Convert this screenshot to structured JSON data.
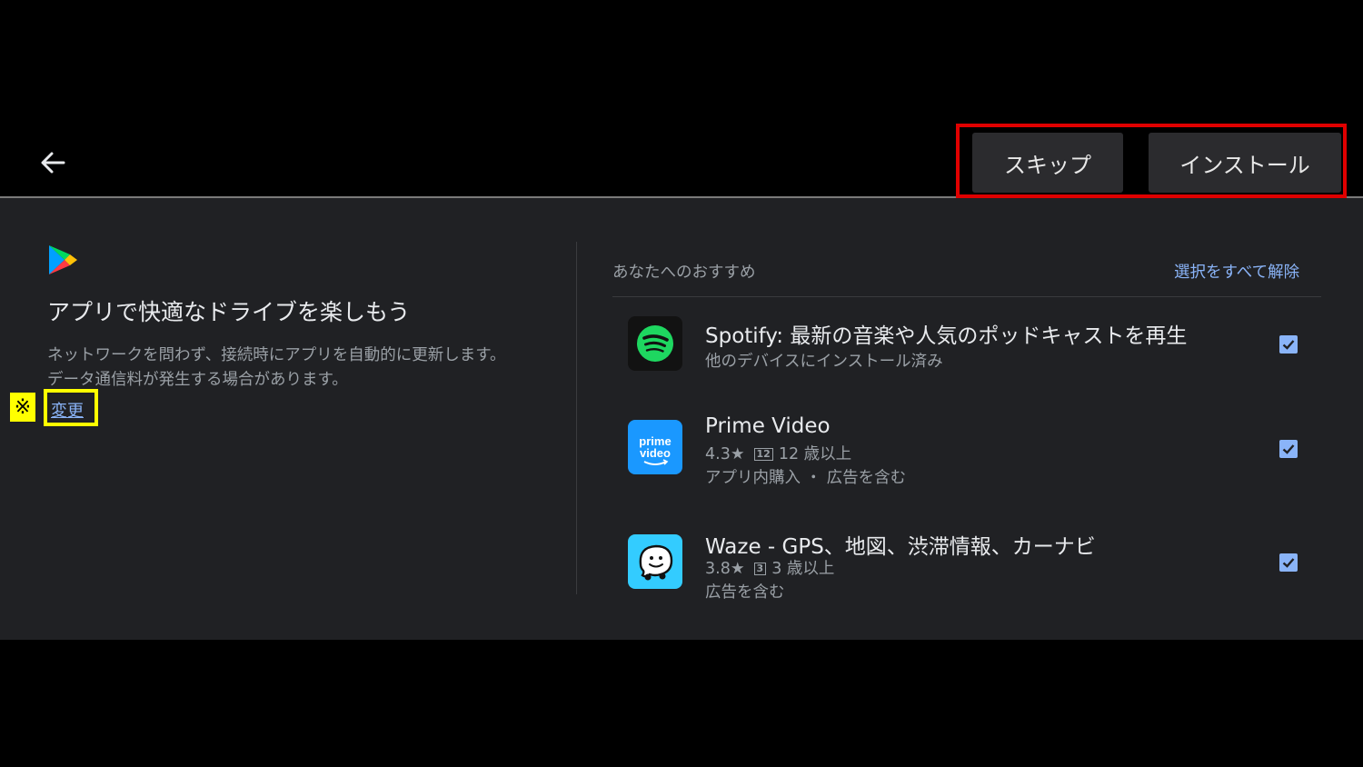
{
  "header": {
    "skip_label": "スキップ",
    "install_label": "インストール"
  },
  "left": {
    "title": "アプリで快適なドライブを楽しもう",
    "desc_line1": "ネットワークを問わず、接続時にアプリを自動的に更新します。",
    "desc_line2": "データ通信料が発生する場合があります。",
    "change_link": "変更",
    "note_mark": "※"
  },
  "recommend": {
    "label": "あなたへのおすすめ",
    "deselect_all": "選択をすべて解除",
    "apps": [
      {
        "title": "Spotify: 最新の音楽や人気のポッドキャストを再生",
        "line1": "他のデバイスにインストール済み",
        "icon": "spotify-icon",
        "checked": true
      },
      {
        "title": "Prime Video",
        "rating": "4.3★",
        "badge": "12",
        "age": "12 歳以上",
        "line2": "アプリ内購入 ・ 広告を含む",
        "icon": "prime-video-icon",
        "icon_text": "prime video",
        "checked": true
      },
      {
        "title": "Waze - GPS、地図、渋滞情報、カーナビ",
        "rating": "3.8★",
        "badge": "3",
        "age": "3 歳以上",
        "line2": "広告を含む",
        "icon": "waze-icon",
        "checked": true
      }
    ]
  },
  "colors": {
    "accent": "#8ab4f8",
    "highlight_red": "#e00000",
    "highlight_yellow": "#ffff00",
    "panel_bg": "#202124"
  }
}
